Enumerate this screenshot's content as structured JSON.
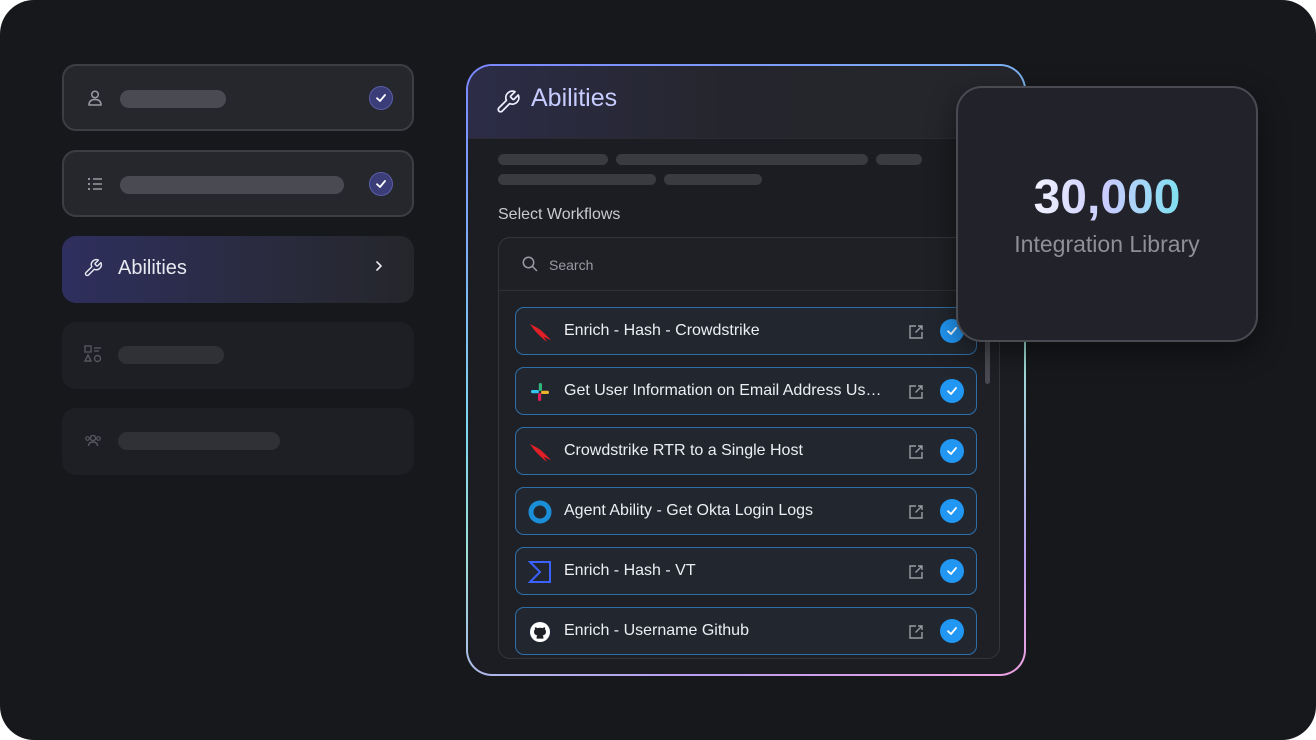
{
  "steps": {
    "active_label": "Abilities",
    "icons": [
      "user-icon",
      "list-icon",
      "wrench-icon",
      "shapes-icon",
      "team-icon"
    ]
  },
  "panel": {
    "title": "Abilities",
    "section_label": "Select Workflows",
    "search_placeholder": "Search",
    "workflows": [
      {
        "label": "Enrich - Hash - Crowdstrike",
        "logo": "crowdstrike-falcon-logo",
        "selected": true
      },
      {
        "label": "Get User Information on Email Address Usi…",
        "logo": "slack-logo",
        "selected": true
      },
      {
        "label": "Crowdstrike RTR to a Single Host",
        "logo": "crowdstrike-falcon-logo",
        "selected": true
      },
      {
        "label": "Agent Ability - Get Okta Login Logs",
        "logo": "okta-logo",
        "selected": true
      },
      {
        "label": "Enrich - Hash - VT",
        "logo": "virustotal-logo",
        "selected": true
      },
      {
        "label": "Enrich - Username Github",
        "logo": "github-logo",
        "selected": true
      }
    ]
  },
  "stat": {
    "value": "30,000",
    "label": "Integration Library"
  },
  "colors": {
    "background": "#17181c",
    "accent": "#2196f3",
    "check_done": "#3a3d78"
  }
}
